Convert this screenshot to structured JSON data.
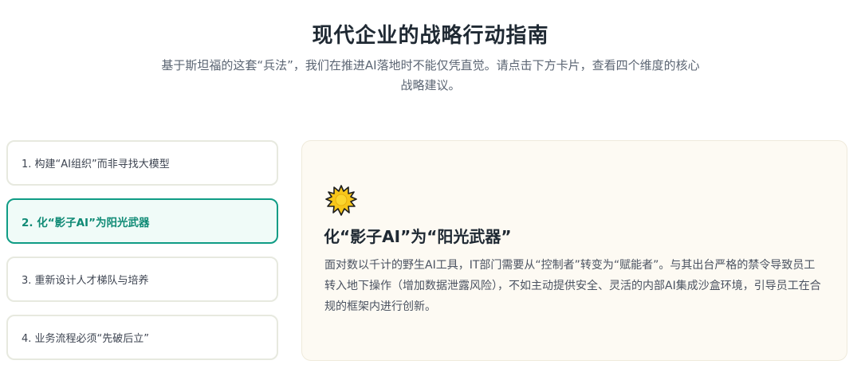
{
  "header": {
    "title": "现代企业的战略行动指南",
    "subtitle": "基于斯坦福的这套“兵法”，我们在推进AI落地时不能仅凭直觉。请点击下方卡片，查看四个维度的核心战略建议。"
  },
  "cards": [
    {
      "label": "1. 构建“AI组织”而非寻找大模型",
      "active": false
    },
    {
      "label": "2. 化“影子AI”为阳光武器",
      "active": true
    },
    {
      "label": "3. 重新设计人才梯队与培养",
      "active": false
    },
    {
      "label": "4. 业务流程必须“先破后立”",
      "active": false
    }
  ],
  "detail": {
    "icon": "sun-icon",
    "title": "化“影子AI”为“阳光武器”",
    "body": "面对数以千计的野生AI工具，IT部门需要从“控制者”转变为“赋能者”。与其出台严格的禁令导致员工转入地下操作（增加数据泄露风险），不如主动提供安全、灵活的内部AI集成沙盒环境，引导员工在合规的框架内进行创新。"
  },
  "colors": {
    "accent": "#0f9c85",
    "active_bg": "#f0fbf8",
    "detail_bg": "#fdfaf3",
    "card_border": "#e7e9df"
  }
}
